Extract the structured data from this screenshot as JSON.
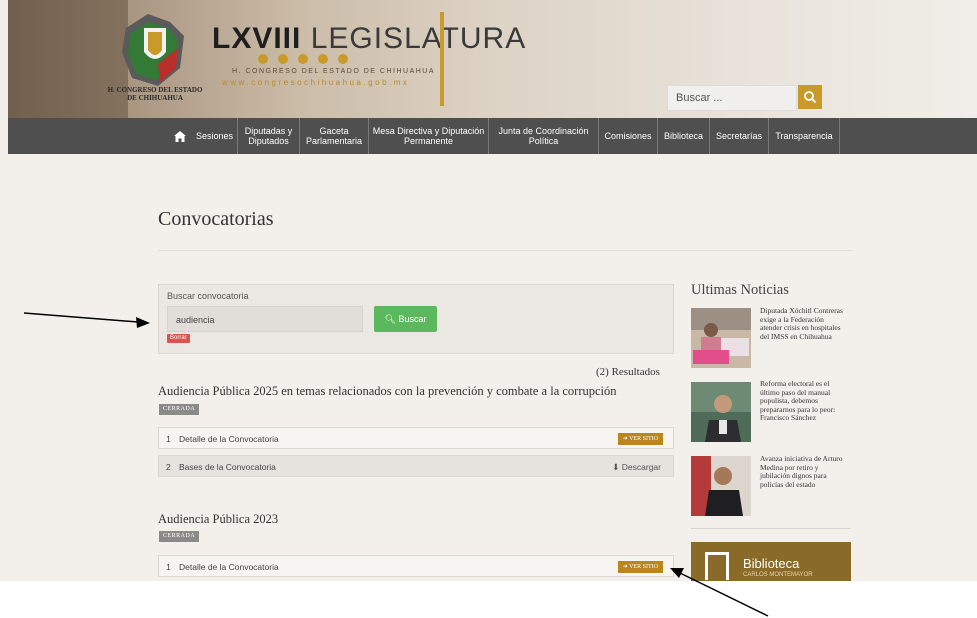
{
  "header": {
    "legislatura_bold": "LXVIII",
    "legislatura_rest": " LEGISLATURA",
    "congreso_line": "H. CONGRESO DEL ESTADO DE CHIHUAHUA",
    "website": "www.congresochihuahua.gob.mx",
    "emblem_label_line1": "H. CONGRESO DEL ESTADO",
    "emblem_label_line2": "DE CHIHUAHUA",
    "search_placeholder": "Buscar ...",
    "search_icon": "search-icon"
  },
  "nav": {
    "home_icon": "home-icon",
    "items": [
      {
        "label": "Sesiones"
      },
      {
        "label": "Diputadas y Diputados"
      },
      {
        "label": "Gaceta Parlamentaria"
      },
      {
        "label": "Mesa Directiva y Diputación Permanente"
      },
      {
        "label": "Junta de Coordinación Política"
      },
      {
        "label": "Comisiones"
      },
      {
        "label": "Biblioteca"
      },
      {
        "label": "Secretarías"
      },
      {
        "label": "Transparencia"
      }
    ]
  },
  "main": {
    "title": "Convocatorias",
    "search": {
      "label": "Buscar convocatoria",
      "value": "audiencia",
      "button": "Buscar",
      "clear": "Borrar"
    },
    "results": "(2) Resultados",
    "convocatorias": [
      {
        "title": "Audiencia Pública 2025 en temas relacionados con la prevención y combate a la corrupción",
        "status": "CERRADA",
        "rows": [
          {
            "num": "1",
            "label": "Detalle de la Convocatoria",
            "action": "VER SITIO"
          },
          {
            "num": "2",
            "label": "Bases de la Convocatoria",
            "action": "Descargar"
          }
        ]
      },
      {
        "title": "Audiencia Pública 2023",
        "status": "CERRADA",
        "rows": [
          {
            "num": "1",
            "label": "Detalle de la Convocatoria",
            "action": "VER SITIO"
          }
        ]
      }
    ]
  },
  "sidebar": {
    "title": "Ultimas Noticias",
    "news": [
      {
        "text": "Diputada Xóchitl Contreras exige a la Federación atender crisis en hospitales del IMSS en Chihuahua"
      },
      {
        "text": "Reforma electoral es el último paso del manual populista, debemos prepararnos para lo peor: Francisco Sánchez"
      },
      {
        "text": "Avanza iniciativa de Arturo Medina por retiro y jubilación dignos para policías del estado"
      }
    ],
    "biblioteca": "Biblioteca",
    "biblioteca_sub": "CARLOS MONTEMAYOR"
  },
  "colors": {
    "gold": "#c89a2a",
    "nav_bg": "#4f4f4f",
    "search_button": "#5cb85c",
    "clear_badge": "#d9534f",
    "ver_sitio": "#b9871e"
  }
}
